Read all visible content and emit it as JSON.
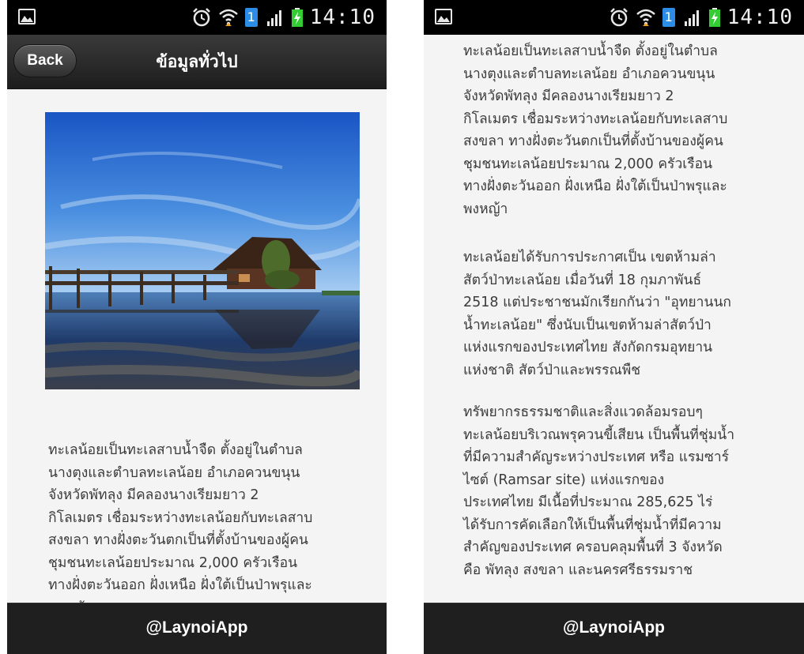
{
  "status_bar": {
    "time": "14:10",
    "sim_slot": "1",
    "icons": [
      "gallery-notification-icon",
      "alarm-clock-icon",
      "wifi-icon",
      "signal-strength-icon",
      "battery-charging-icon"
    ]
  },
  "header": {
    "back_label": "Back",
    "title": "ข้อมูลทั่วไป"
  },
  "footer": {
    "label": "@LaynoiApp"
  },
  "article": {
    "photo_description_icon": "lake-house-photo",
    "paragraph_1": "ทะเลน้อยเป็นทะเลสาบน้ำจืด ตั้งอยู่ในตำบล\nนางตุงและตำบลทะเลน้อย อำเภอควนขนุน\nจังหวัดพัทลุง มีคลองนางเรียมยาว 2\nกิโลเมตร เชื่อมระหว่างทะเลน้อยกับทะเลสาบ\nสงขลา ทางฝั่งตะวันตกเป็นที่ตั้งบ้านของผู้คน\nชุมชนทะเลน้อยประมาณ 2,000 ครัวเรือน\nทางฝั่งตะวันออก ฝั่งเหนือ ฝั่งใต้เป็นป่าพรุและ\nพงหญ้า",
    "paragraph_2": "ทะเลน้อยได้รับการประกาศเป็น เขตห้ามล่า\nสัตว์ป่าทะเลน้อย เมื่อวันที่ 18 กุมภาพันธ์\n2518 แต่ประชาชนมักเรียกกันว่า \"อุทยานนก\nน้ำทะเลน้อย\" ซึ่งนับเป็นเขตห้ามล่าสัตว์ป่า\nแห่งแรกของประเทศไทย สังกัดกรมอุทยาน\nแห่งชาติ สัตว์ป่าและพรรณพืช",
    "paragraph_3": "ทรัพยากรธรรมชาติและสิ่งแวดล้อมรอบๆ\nทะเลน้อยบริเวณพรุควนขี้เสียน เป็นพื้นที่ชุ่มน้ำ\nที่มีความสำคัญระหว่างประเทศ หรือ แรมซาร์\nไซต์ (Ramsar site) แห่งแรกของ\nประเทศไทย มีเนื้อที่ประมาณ 285,625 ไร่\nได้รับการคัดเลือกให้เป็นพื้นที่ชุ่มน้ำที่มีความ\nสำคัญของประเทศ ครอบคลุมพื้นที่ 3 จังหวัด\nคือ พัทลุง สงขลา และนครศรีธรรมราช"
  },
  "colors": {
    "status_bar": "#000000",
    "title_bar": "#2a2a2a",
    "footer_bar": "#1f1f1f",
    "content_bg": "#f4f4f4",
    "body_text": "#3b3b3b",
    "sim_badge": "#2d8de6",
    "battery_charge": "#33cc33"
  }
}
